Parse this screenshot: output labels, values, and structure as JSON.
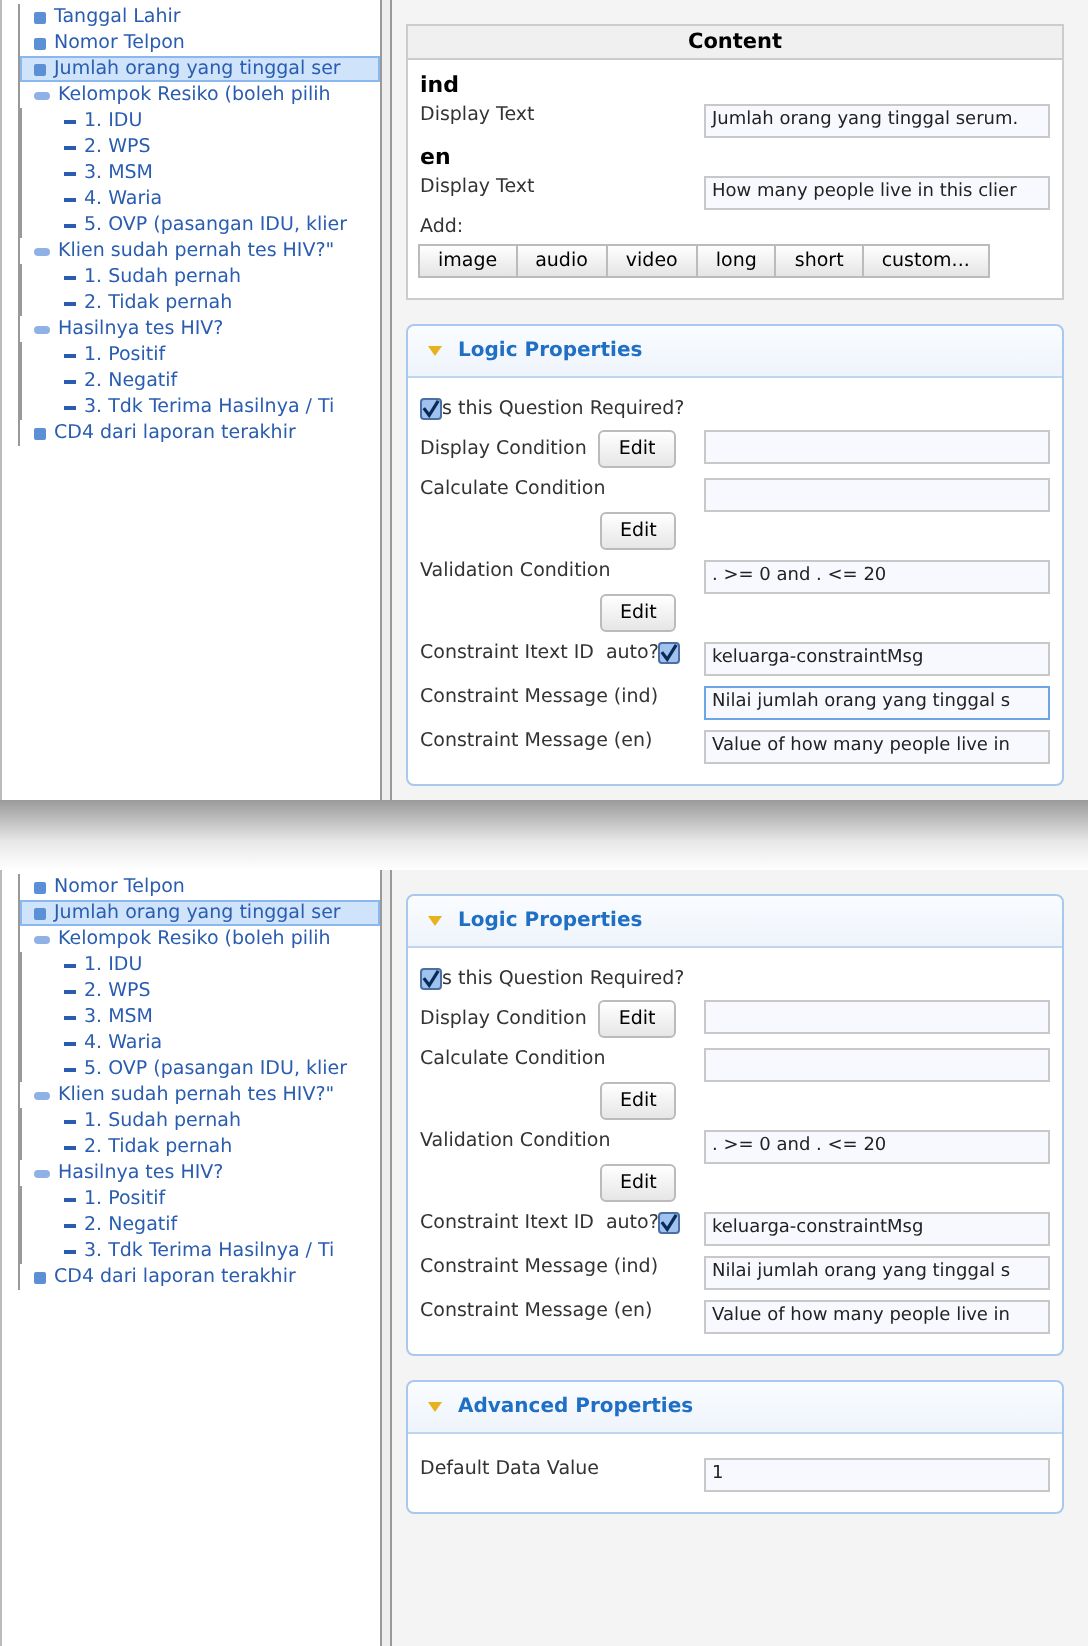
{
  "panes": [
    {
      "tree": [
        {
          "label": "Tanggal Lahir",
          "kind": "question",
          "selected": false
        },
        {
          "label": "Nomor Telpon",
          "kind": "question",
          "selected": false
        },
        {
          "label": "Jumlah orang yang tinggal ser",
          "kind": "question",
          "selected": true
        },
        {
          "label": "Kelompok Resiko (boleh pilih",
          "kind": "group",
          "selected": false,
          "children": [
            {
              "label": "1. IDU",
              "kind": "option",
              "selected": false
            },
            {
              "label": "2. WPS",
              "kind": "option",
              "selected": false
            },
            {
              "label": "3. MSM",
              "kind": "option",
              "selected": false
            },
            {
              "label": "4. Waria",
              "kind": "option",
              "selected": false
            },
            {
              "label": "5. OVP (pasangan IDU, klier",
              "kind": "option",
              "selected": false
            }
          ]
        },
        {
          "label": "Klien sudah pernah tes HIV?\"",
          "kind": "group",
          "selected": false,
          "children": [
            {
              "label": "1. Sudah pernah",
              "kind": "option",
              "selected": false
            },
            {
              "label": "2. Tidak pernah",
              "kind": "option",
              "selected": false
            }
          ]
        },
        {
          "label": "Hasilnya tes HIV?",
          "kind": "group",
          "selected": false,
          "children": [
            {
              "label": "1. Positif",
              "kind": "option",
              "selected": false
            },
            {
              "label": "2. Negatif",
              "kind": "option",
              "selected": false
            },
            {
              "label": "3. Tdk Terima Hasilnya / Ti",
              "kind": "option",
              "selected": false
            }
          ]
        },
        {
          "label": "CD4 dari laporan terakhir",
          "kind": "question",
          "selected": false
        }
      ],
      "content": {
        "title": "Content",
        "languages": [
          {
            "code": "ind",
            "label": "Display Text",
            "value": "Jumlah orang yang tinggal serum."
          },
          {
            "code": "en",
            "label": "Display Text",
            "value": "How many people live in this clier"
          }
        ],
        "add_label": "Add:",
        "add_buttons": [
          "image",
          "audio",
          "video",
          "long",
          "short",
          "custom..."
        ]
      },
      "logic": {
        "title": "Logic Properties",
        "required": {
          "label": "s this Question Required?",
          "checked": true
        },
        "rows": [
          {
            "kind": "edit-inline",
            "label": "Display Condition",
            "button": "Edit"
          },
          {
            "kind": "edit-below",
            "label": "Calculate Condition",
            "button": "Edit"
          },
          {
            "kind": "edit-below",
            "label": "Validation Condition",
            "button": "Edit",
            "value": ". >= 0 and . <= 20"
          },
          {
            "kind": "auto",
            "label": "Constraint Itext ID",
            "auto_label": "auto?",
            "checked": true,
            "value": "keluarga-constraintMsg"
          },
          {
            "kind": "text",
            "label": "Constraint Message (ind)",
            "value": "Nilai jumlah orang yang tinggal s",
            "focused": true
          },
          {
            "kind": "text",
            "label": "Constraint Message (en)",
            "value": "Value of how many people live in",
            "focused": false
          }
        ]
      }
    },
    {
      "tree": [
        {
          "label": "Nomor Telpon",
          "kind": "question",
          "selected": false
        },
        {
          "label": "Jumlah orang yang tinggal ser",
          "kind": "question",
          "selected": true
        },
        {
          "label": "Kelompok Resiko (boleh pilih",
          "kind": "group",
          "selected": false,
          "children": [
            {
              "label": "1. IDU",
              "kind": "option",
              "selected": false
            },
            {
              "label": "2. WPS",
              "kind": "option",
              "selected": false
            },
            {
              "label": "3. MSM",
              "kind": "option",
              "selected": false
            },
            {
              "label": "4. Waria",
              "kind": "option",
              "selected": false
            },
            {
              "label": "5. OVP (pasangan IDU, klier",
              "kind": "option",
              "selected": false
            }
          ]
        },
        {
          "label": "Klien sudah pernah tes HIV?\"",
          "kind": "group",
          "selected": false,
          "children": [
            {
              "label": "1. Sudah pernah",
              "kind": "option",
              "selected": false
            },
            {
              "label": "2. Tidak pernah",
              "kind": "option",
              "selected": false
            }
          ]
        },
        {
          "label": "Hasilnya tes HIV?",
          "kind": "group",
          "selected": false,
          "children": [
            {
              "label": "1. Positif",
              "kind": "option",
              "selected": false
            },
            {
              "label": "2. Negatif",
              "kind": "option",
              "selected": false
            },
            {
              "label": "3. Tdk Terima Hasilnya / Ti",
              "kind": "option",
              "selected": false
            }
          ]
        },
        {
          "label": "CD4 dari laporan terakhir",
          "kind": "question",
          "selected": false
        }
      ],
      "logic": {
        "title": "Logic Properties",
        "required": {
          "label": "s this Question Required?",
          "checked": true
        },
        "rows": [
          {
            "kind": "edit-inline",
            "label": "Display Condition",
            "button": "Edit"
          },
          {
            "kind": "edit-below",
            "label": "Calculate Condition",
            "button": "Edit"
          },
          {
            "kind": "edit-below",
            "label": "Validation Condition",
            "button": "Edit",
            "value": ". >= 0 and . <= 20"
          },
          {
            "kind": "auto",
            "label": "Constraint Itext ID",
            "auto_label": "auto?",
            "checked": true,
            "value": "keluarga-constraintMsg"
          },
          {
            "kind": "text",
            "label": "Constraint Message (ind)",
            "value": "Nilai jumlah orang yang tinggal s",
            "focused": false
          },
          {
            "kind": "text",
            "label": "Constraint Message (en)",
            "value": "Value of how many people live in",
            "focused": false
          }
        ]
      },
      "advanced": {
        "title": "Advanced Properties",
        "rows": [
          {
            "label": "Default Data Value",
            "value": "1"
          }
        ]
      }
    }
  ]
}
